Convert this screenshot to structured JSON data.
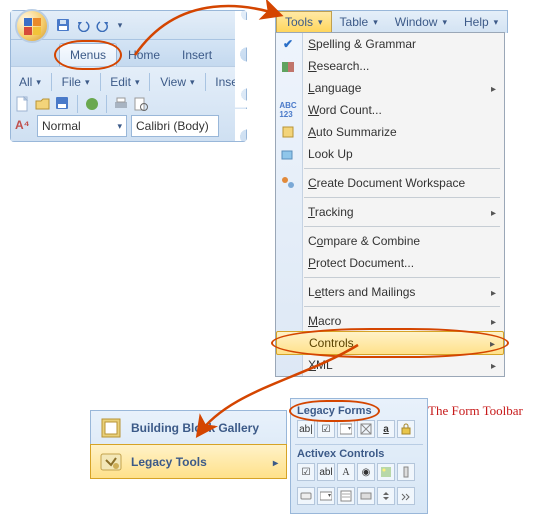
{
  "ribbon": {
    "tab_menus": "Menus",
    "tab_home": "Home",
    "tab_insert": "Insert",
    "bar1": {
      "all": "All",
      "file": "File",
      "edit": "Edit",
      "view": "View",
      "ins": "Inse"
    },
    "bar2": {
      "style": "Normal",
      "font": "Calibri (Body)"
    }
  },
  "menubar": {
    "tools": "Tools",
    "table": "Table",
    "window": "Window",
    "help": "Help"
  },
  "menu": {
    "spelling": "Spelling & Grammar",
    "research": "Research...",
    "language": "Language",
    "wordcount": "Word Count...",
    "autosum": "Auto Summarize",
    "lookup": "Look Up",
    "workspace": "Create Document Workspace",
    "tracking": "Tracking",
    "compare": "Compare & Combine",
    "protect": "Protect Document...",
    "letters": "Letters and Mailings",
    "macro": "Macro",
    "controls": "Controls",
    "xml": "XML"
  },
  "popup": {
    "gallery": "Building Block Gallery",
    "legacy": "Legacy Tools"
  },
  "formsPanel": {
    "legacyForms": "Legacy Forms",
    "activex": "Activex Controls"
  },
  "caption": "The Form Toolbar"
}
